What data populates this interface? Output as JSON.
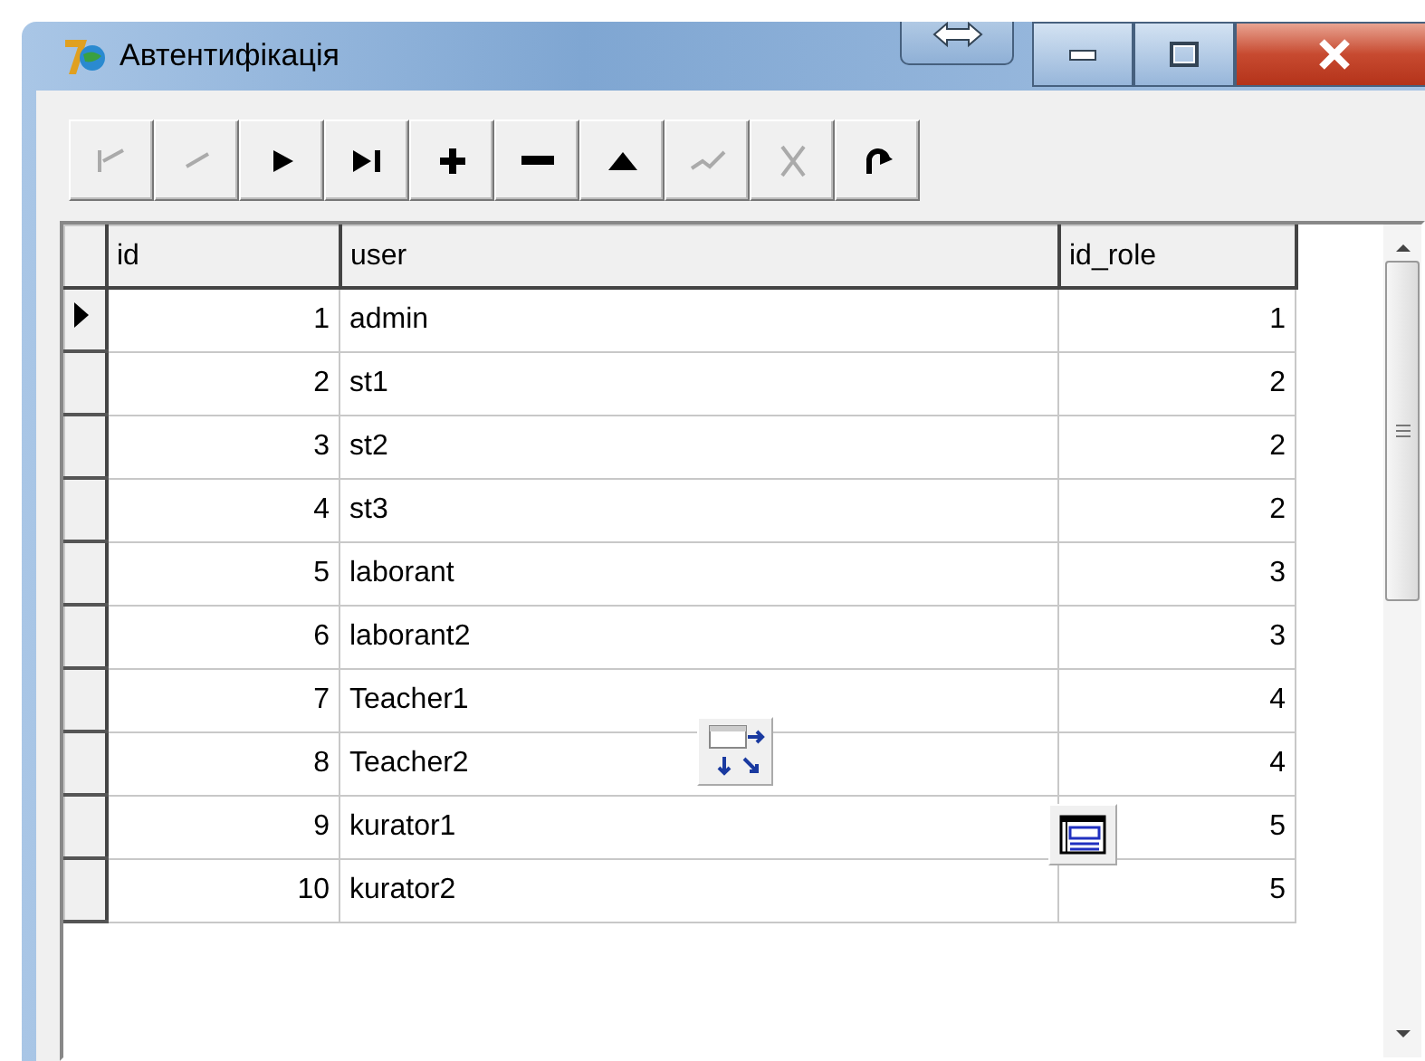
{
  "window": {
    "title": "Автентифікація"
  },
  "navigator": [
    {
      "kind": "first",
      "disabled": true
    },
    {
      "kind": "prior",
      "disabled": true
    },
    {
      "kind": "next",
      "disabled": false
    },
    {
      "kind": "last",
      "disabled": false
    },
    {
      "kind": "insert",
      "disabled": false
    },
    {
      "kind": "delete",
      "disabled": false
    },
    {
      "kind": "edit",
      "disabled": false
    },
    {
      "kind": "post",
      "disabled": true
    },
    {
      "kind": "cancel",
      "disabled": true
    },
    {
      "kind": "refresh",
      "disabled": false
    }
  ],
  "grid": {
    "columns": [
      "id",
      "user",
      "id_role"
    ],
    "rows": [
      {
        "selected": true,
        "cells": [
          "1",
          "admin",
          "1"
        ]
      },
      {
        "selected": false,
        "cells": [
          "2",
          "st1",
          "2"
        ]
      },
      {
        "selected": false,
        "cells": [
          "3",
          "st2",
          "2"
        ]
      },
      {
        "selected": false,
        "cells": [
          "4",
          "st3",
          "2"
        ]
      },
      {
        "selected": false,
        "cells": [
          "5",
          "laborant",
          "3"
        ]
      },
      {
        "selected": false,
        "cells": [
          "6",
          "laborant2",
          "3"
        ]
      },
      {
        "selected": false,
        "cells": [
          "7",
          "Teacher1",
          "4"
        ]
      },
      {
        "selected": false,
        "cells": [
          "8",
          "Teacher2",
          "4"
        ]
      },
      {
        "selected": false,
        "cells": [
          "9",
          "kurator1",
          "5"
        ]
      },
      {
        "selected": false,
        "cells": [
          "10",
          "kurator2",
          "5"
        ]
      }
    ]
  }
}
